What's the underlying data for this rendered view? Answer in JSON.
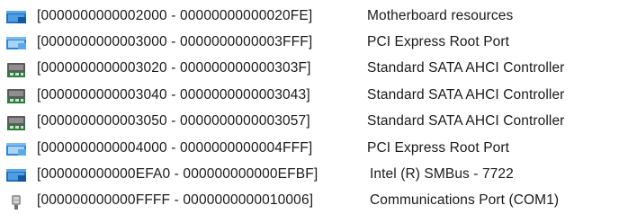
{
  "resources": [
    {
      "icon": "device-folder-icon",
      "range": "[0000000000002000 - 00000000000020FE]",
      "device": "Motherboard resources"
    },
    {
      "icon": "device-folder-icon",
      "range": "[0000000000003000 - 0000000000003FFF]",
      "device": "PCI Express Root Port"
    },
    {
      "icon": "storage-controller-icon",
      "range": "[0000000000003020 - 000000000000303F]",
      "device": "Standard SATA AHCI Controller"
    },
    {
      "icon": "storage-controller-icon",
      "range": "[0000000000003040 - 0000000000003043]",
      "device": "Standard SATA AHCI Controller"
    },
    {
      "icon": "storage-controller-icon",
      "range": "[0000000000003050 - 0000000000003057]",
      "device": "Standard SATA AHCI Controller"
    },
    {
      "icon": "device-folder-icon",
      "range": "[0000000000004000 - 0000000000004FFF]",
      "device": "PCI Express Root Port"
    },
    {
      "icon": "device-folder-icon",
      "range": "[000000000000EFA0 - 000000000000EFBF]",
      "device": "Intel (R) SMBus - 7722"
    },
    {
      "icon": "port-connector-icon",
      "range": "[000000000000FFFF - 0000000000010006]",
      "device": "Communications Port (COM1)"
    }
  ]
}
